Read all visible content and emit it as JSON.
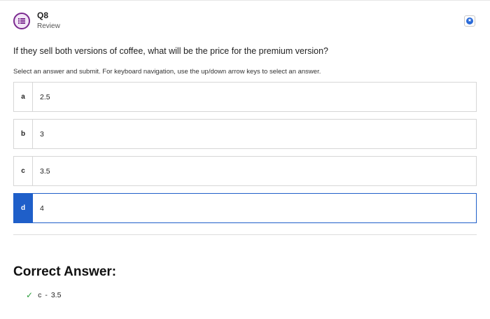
{
  "header": {
    "question_number": "Q8",
    "status": "Review",
    "icon": "question-list-icon"
  },
  "question": {
    "text": "If they sell both versions of coffee, what will be the price for the premium version?",
    "instructions": "Select an answer and submit. For keyboard navigation, use the up/down arrow keys to select an answer."
  },
  "options": [
    {
      "letter": "a",
      "value": "2.5",
      "selected": false
    },
    {
      "letter": "b",
      "value": "3",
      "selected": false
    },
    {
      "letter": "c",
      "value": "3.5",
      "selected": false
    },
    {
      "letter": "d",
      "value": "4",
      "selected": true
    }
  ],
  "correct_answer": {
    "title": "Correct Answer:",
    "letter": "c",
    "separator": "-",
    "value": "3.5",
    "icon": "check-icon"
  },
  "colors": {
    "selected_accent": "#1f5fc9",
    "icon_purple": "#7b2a8f",
    "check_green": "#2a9d3a"
  }
}
